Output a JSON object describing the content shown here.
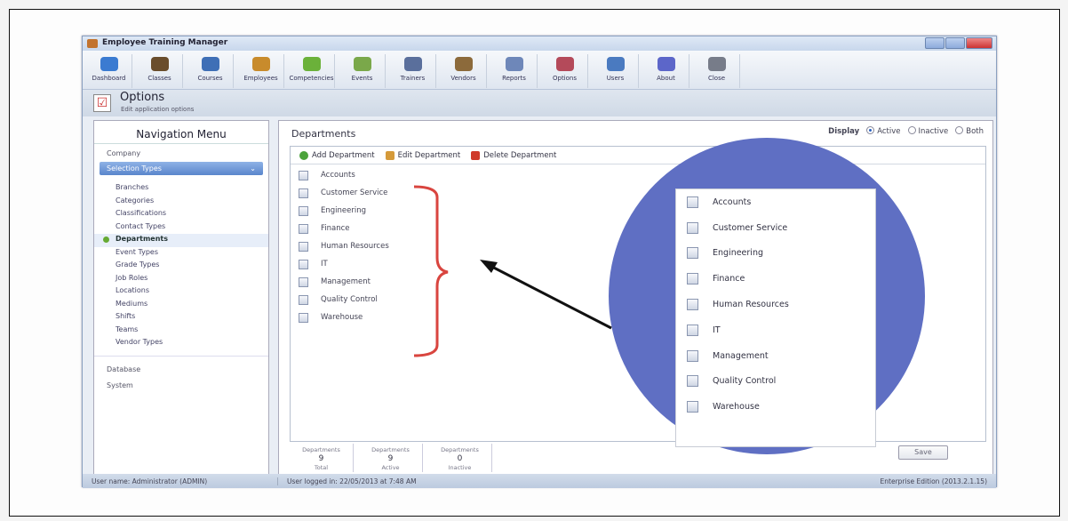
{
  "window": {
    "title": "Employee Training Manager"
  },
  "toolbar": {
    "buttons": [
      {
        "label": "Dashboard",
        "icon": "dashboard-icon",
        "color": "#3b7bd1"
      },
      {
        "label": "Classes",
        "icon": "classes-icon",
        "color": "#6a4d2c"
      },
      {
        "label": "Courses",
        "icon": "courses-icon",
        "color": "#3f6fb6"
      },
      {
        "label": "Employees",
        "icon": "employees-icon",
        "color": "#c88b2c"
      },
      {
        "label": "Competencies",
        "icon": "competencies-icon",
        "color": "#6bb13a"
      },
      {
        "label": "Events",
        "icon": "events-icon",
        "color": "#7aa84a"
      },
      {
        "label": "Trainers",
        "icon": "trainers-icon",
        "color": "#5a6f9c"
      },
      {
        "label": "Vendors",
        "icon": "vendors-icon",
        "color": "#8c6a3b"
      },
      {
        "label": "Reports",
        "icon": "reports-icon",
        "color": "#6e87b9"
      },
      {
        "label": "Options",
        "icon": "options-icon",
        "color": "#b44a5a"
      },
      {
        "label": "Users",
        "icon": "users-icon",
        "color": "#4a7ac0"
      },
      {
        "label": "About",
        "icon": "about-icon",
        "color": "#5c66c9"
      },
      {
        "label": "Close",
        "icon": "close-icon",
        "color": "#777c89"
      }
    ]
  },
  "page": {
    "title": "Options",
    "subtitle": "Edit application options"
  },
  "nav": {
    "header": "Navigation Menu",
    "company": "Company",
    "selection_types": "Selection Types",
    "items": [
      "Branches",
      "Categories",
      "Classifications",
      "Contact Types",
      "Departments",
      "Event Types",
      "Grade Types",
      "Job Roles",
      "Locations",
      "Mediums",
      "Shifts",
      "Teams",
      "Vendor Types"
    ],
    "active": "Departments",
    "database": "Database",
    "system": "System"
  },
  "main": {
    "title": "Departments",
    "display": {
      "label": "Display",
      "options": [
        "Active",
        "Inactive",
        "Both"
      ],
      "selected": "Active"
    },
    "actions": {
      "add": "Add Department",
      "edit": "Edit Department",
      "delete": "Delete Department"
    },
    "departments": [
      "Accounts",
      "Customer Service",
      "Engineering",
      "Finance",
      "Human Resources",
      "IT",
      "Management",
      "Quality Control",
      "Warehouse"
    ],
    "summary": [
      {
        "caption": "Departments",
        "value": "9",
        "sub": "Total"
      },
      {
        "caption": "Departments",
        "value": "9",
        "sub": "Active"
      },
      {
        "caption": "Departments",
        "value": "0",
        "sub": "Inactive"
      }
    ],
    "save": "Save"
  },
  "status": {
    "user": "User name: Administrator (ADMIN)",
    "logged": "User logged in: 22/05/2013 at 7:48 AM",
    "edition": "Enterprise Edition (2013.2.1.15)"
  },
  "annotation": {
    "zoom_items": [
      "Accounts",
      "Customer Service",
      "Engineering",
      "Finance",
      "Human Resources",
      "IT",
      "Management",
      "Quality Control",
      "Warehouse"
    ],
    "circle_color": "#5f6fc3",
    "bracket_color": "#d9453f"
  }
}
